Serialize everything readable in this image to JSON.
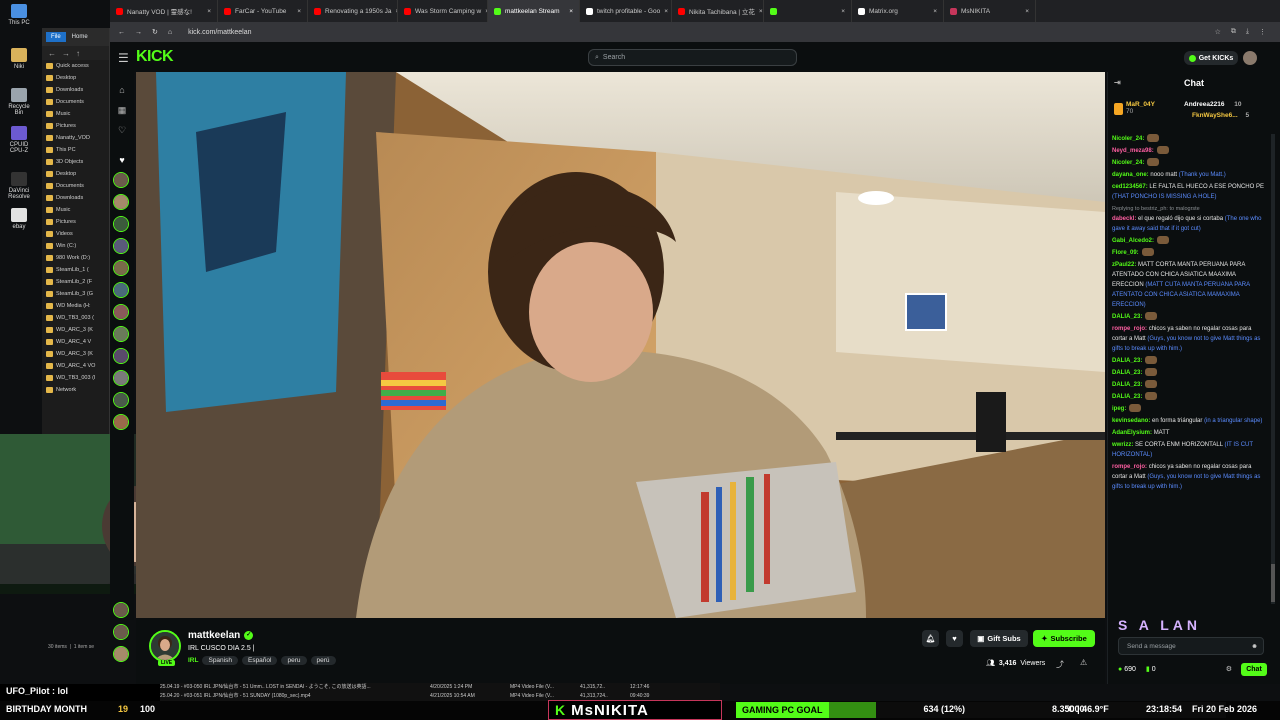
{
  "desktop": {
    "icons": [
      {
        "label": "This PC",
        "color": "#4a90e2"
      },
      {
        "label": "Niki",
        "color": "#d9b25b"
      },
      {
        "label": "Recycle Bin",
        "color": "#9aa4ad"
      },
      {
        "label": "CPUID CPU-Z",
        "color": "#6c5ad1"
      },
      {
        "label": "DaVinci Resolve",
        "color": "#333"
      },
      {
        "label": "ebay",
        "color": "#e2e2e2"
      }
    ]
  },
  "explorer": {
    "ribbon_file": "File",
    "ribbon_home": "Home",
    "items": [
      "Quick access",
      "Desktop",
      "Downloads",
      "Documents",
      "Music",
      "Pictures",
      "Nanatty_VOD",
      "This PC",
      "3D Objects",
      "Desktop",
      "Documents",
      "Downloads",
      "Music",
      "Pictures",
      "Videos",
      "Win (C:)",
      "980 Work (D:)",
      "SteamLib_1 (",
      "SteamLib_2 (F",
      "SteamLib_3 (G",
      "WD Media (H:",
      "WD_TB3_003 (",
      "WD_ARC_3 (K",
      "WD_ARC_4 V",
      "WD_ARC_3 (K",
      "WD_ARC_4 VO",
      "WD_TB3_003 (I",
      "Network"
    ],
    "status_count": "30 items",
    "status_sel": "1 item se"
  },
  "browser": {
    "tabs": [
      {
        "label": "Nanatty VOD | 霊感な!",
        "color": "#ff0000"
      },
      {
        "label": "FarCar - YouTube",
        "color": "#ff0000"
      },
      {
        "label": "Renovating a 1950s Ja",
        "color": "#ff0000"
      },
      {
        "label": "Was Storm Camping w",
        "color": "#ff0000"
      },
      {
        "label": "mattkeelan Stream",
        "color": "#53fc18"
      },
      {
        "label": "twitch profitable - Goo",
        "color": "#fff"
      },
      {
        "label": "Nikita Tachibana | 立花",
        "color": "#ff0000"
      },
      {
        "label": "",
        "color": "#53fc18"
      },
      {
        "label": "Matrix.org",
        "color": "#fff"
      },
      {
        "label": "MsNIKITA",
        "color": "#c6365b"
      }
    ],
    "url": "kick.com/mattkeelan"
  },
  "kick": {
    "logo": "KICK",
    "search_placeholder": "Search",
    "get_kicks": "Get KICKs"
  },
  "channel": {
    "name": "mattkeelan",
    "title": "IRL CUSCO DIA 2.5 |",
    "category": "IRL",
    "tags": [
      "Spanish",
      "Español",
      "peru",
      "perú"
    ],
    "live": "LIVE",
    "gift_subs": "Gift Subs",
    "subscribe": "Subscribe",
    "viewers_count": "3,416",
    "viewers_label": "Viewers"
  },
  "chat": {
    "title": "Chat",
    "pins": [
      {
        "user": "MaR_04Y",
        "value": "70"
      },
      {
        "user": "Andreea2216",
        "value": "10"
      },
      {
        "user": "FknWayShe6...",
        "value": "5"
      }
    ],
    "messages": [
      {
        "user": "Nicoler_24:",
        "color": "#53fc18",
        "text": "",
        "tr": ""
      },
      {
        "user": "Neyd_meza98:",
        "color": "#ff5fa2",
        "text": "",
        "tr": ""
      },
      {
        "user": "Nicoler_24:",
        "color": "#53fc18",
        "text": "",
        "tr": ""
      },
      {
        "user": "dayana_one:",
        "color": "#53fc18",
        "text": "nooo matt",
        "tr": "(Thank you Matt.)"
      },
      {
        "user": "ced1234567:",
        "color": "#53fc18",
        "text": "LE FALTA EL HUECO A ESE PONCHO PE",
        "tr": "(THAT PONCHO IS MISSING A HOLE)"
      },
      {
        "reply": "Replying to bestriz_ph: to malogrste",
        "user": "dabeckl:",
        "color": "#ff5fa2",
        "text": "el que regaló dijo que si cortaba",
        "tr": "(The one who gave it away said that if it got cut)"
      },
      {
        "user": "Gabi_Alcedo2:",
        "color": "#53fc18",
        "text": "",
        "tr": ""
      },
      {
        "user": "Flore_09:",
        "color": "#53fc18",
        "text": "",
        "tr": ""
      },
      {
        "user": "zPaul22:",
        "color": "#53fc18",
        "text": "MATT CORTA MANTA PERUANA PARA ATENTADO CON CHICA ASIATICA MAAXIMA ERECCION",
        "tr": "(MATT CUTA MANTA PERUANA PARA ATENTATO CON CHICA ASIATICA MAMAXIMA ERECCION)"
      },
      {
        "user": "DALIA_23:",
        "color": "#53fc18",
        "text": "",
        "tr": ""
      },
      {
        "user": "rompe_rojo:",
        "color": "#ff5fa2",
        "text": "chicos ya saben no regalar cosas para cortar a Matt",
        "tr": "(Guys, you know not to give Matt things as gifts to break up with him.)"
      },
      {
        "user": "DALIA_23:",
        "color": "#53fc18",
        "text": "",
        "tr": ""
      },
      {
        "user": "DALIA_23:",
        "color": "#53fc18",
        "text": "",
        "tr": ""
      },
      {
        "user": "DALIA_23:",
        "color": "#53fc18",
        "text": "",
        "tr": ""
      },
      {
        "user": "DALIA_23:",
        "color": "#53fc18",
        "text": "",
        "tr": ""
      },
      {
        "user": "ipeg:",
        "color": "#53fc18",
        "text": "",
        "tr": ""
      },
      {
        "user": "kevinsedano:",
        "color": "#53fc18",
        "text": "en forma triángular",
        "tr": "(in a triangular shape)"
      },
      {
        "user": "AdanElysium:",
        "color": "#53fc18",
        "text": "MATT",
        "tr": ""
      },
      {
        "user": "wwrizz:",
        "color": "#53fc18",
        "text": "SE CORTA ENM HORIZONTALL",
        "tr": "(IT IS CUT HORIZONTAL)"
      },
      {
        "user": "rompe_rojo:",
        "color": "#ff5fa2",
        "text": "chicos ya saben no regalar cosas para cortar a Matt",
        "tr": "(Guys, you know not to give Matt things as gifts to break up with him.)"
      }
    ],
    "emote_banner": "S A LAN",
    "send_placeholder": "Send a message",
    "points": "690",
    "count": "0",
    "chat_button": "Chat"
  },
  "files": {
    "rows": [
      {
        "name": "25.04.19 - #03-050 IRL JPN/仙台市 - 51 Umm.. LOST in SENDAI - ようこそ, この放送は英語...",
        "date": "4/20/2025 1:24 PM",
        "type": "MP4 Video File (V...",
        "size": "41,315,72..",
        "dur": "12:17:46"
      },
      {
        "name": "25.04.20 - #03-051 IRL JPN/仙台市 - 51 SUNDAY (1080p_sec).mp4",
        "date": "4/21/2025 10:54 AM",
        "type": "MP4 Video File (V...",
        "size": "41,313,724..",
        "dur": "09:40:39"
      }
    ]
  },
  "overlay": {
    "ufo": "UFO_Pilot : lol",
    "birthday": "BIRTHDAY MONTH",
    "bday_num": "19",
    "pct100": "100",
    "msnikita_k": "K",
    "msnikita": "MsNIKITA",
    "goal_label": "GAMING PC GOAL",
    "goal_progress": "634 (12%)",
    "goal_fraction": 0.12,
    "goal_target": "5000",
    "temp": "8.3°C | 46.9°F",
    "time": "23:18:54",
    "date": "Fri 20 Feb 2026"
  }
}
